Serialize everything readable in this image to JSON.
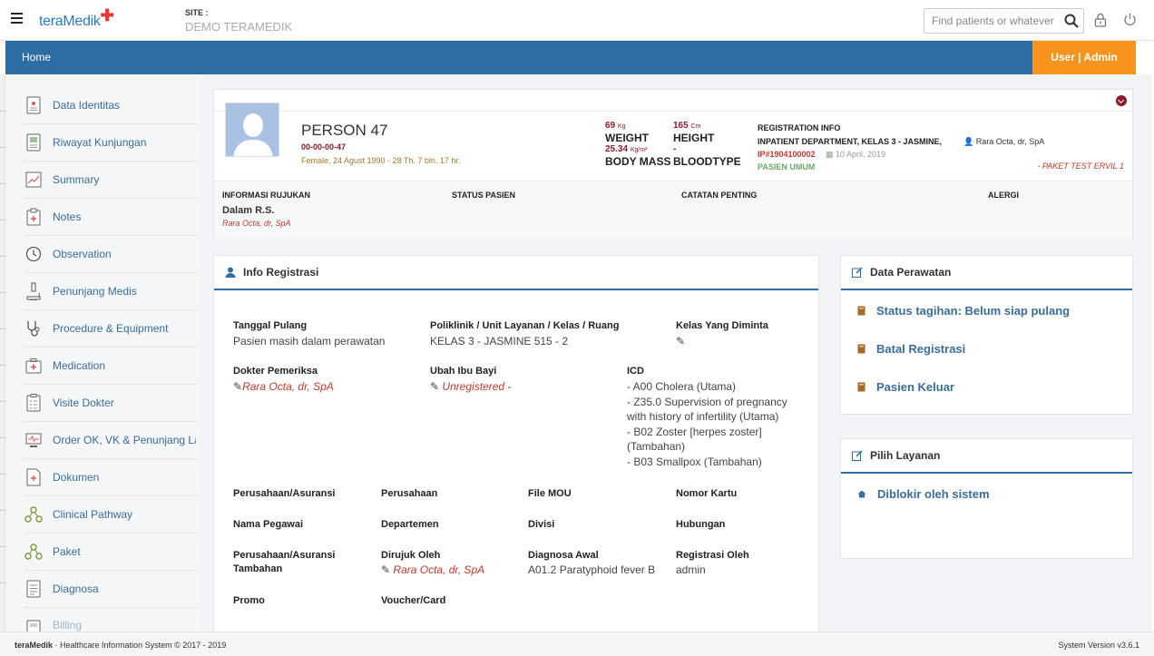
{
  "topbar": {
    "logo_text": "teraMedik",
    "site_label": "SITE :",
    "site_name": "DEMO TERAMEDIK",
    "search_placeholder": "Find patients or whatever"
  },
  "nav": {
    "home": "Home",
    "user": "User | Admin"
  },
  "sidebar": {
    "items": [
      {
        "label": "Data Identitas",
        "icon": "id-card-icon"
      },
      {
        "label": "Riwayat Kunjungan",
        "icon": "visit-history-icon"
      },
      {
        "label": "Summary",
        "icon": "summary-chart-icon"
      },
      {
        "label": "Notes",
        "icon": "notes-icon"
      },
      {
        "label": "Observation",
        "icon": "clock-icon"
      },
      {
        "label": "Penunjang Medis",
        "icon": "microscope-icon"
      },
      {
        "label": "Procedure & Equipment",
        "icon": "stethoscope-icon"
      },
      {
        "label": "Medication",
        "icon": "medkit-icon"
      },
      {
        "label": "Visite Dokter",
        "icon": "clipboard-icon"
      },
      {
        "label": "Order OK, VK & Penunjang La",
        "icon": "monitor-icon"
      },
      {
        "label": "Dokumen",
        "icon": "document-icon"
      },
      {
        "label": "Clinical Pathway",
        "icon": "pathway-icon"
      },
      {
        "label": "Paket",
        "icon": "package-icon"
      },
      {
        "label": "Diagnosa",
        "icon": "diagnosis-icon"
      },
      {
        "label": "Billing",
        "icon": "billing-icon"
      }
    ]
  },
  "patient": {
    "name": "PERSON 47",
    "mrn": "00-00-00-47",
    "info": "Female, 24 Agust 1990 - 28 Th. 7 bln. 17 hr.",
    "weight_value": "69",
    "weight_unit": "Kg",
    "weight_label": "WEIGHT",
    "height_value": "165",
    "height_unit": "Cm",
    "height_label": "HEIGHT",
    "bmi_value": "25.34",
    "bmi_unit": "Kg/m²",
    "bmi_label": "BODY MASS",
    "bloodtype_value": "-",
    "bloodtype_label": "BLOODTYPE",
    "reg_title": "REGISTRATION INFO",
    "reg_dept": "INPATIENT DEPARTMENT, KELAS 3 - JASMINE,",
    "reg_doctor": "Rara Octa, dr, SpA",
    "reg_ip": "IP#1904100002",
    "reg_date": "10 April, 2019",
    "reg_pasien": "PASIEN UMUM",
    "reg_paket": "- PAKET TEST ERVIL 1"
  },
  "info_bar": {
    "rujukan_label": "INFORMASI RUJUKAN",
    "rujukan_value": "Dalam R.S.",
    "rujukan_doctor": "Rara Octa, dr, SpA",
    "status_label": "STATUS PASIEN",
    "catatan_label": "CATATAN PENTING",
    "alergi_label": "ALERGI"
  },
  "registrasi": {
    "title": "Info Registrasi",
    "tanggal_pulang_label": "Tanggal Pulang",
    "tanggal_pulang_value": "Pasien masih dalam perawatan",
    "poliklinik_label": "Poliklinik / Unit Layanan / Kelas / Ruang",
    "poliklinik_value": "KELAS 3 - JASMINE 515 - 2",
    "kelas_label": "Kelas Yang Diminta",
    "dokter_label": "Dokter Pemeriksa",
    "dokter_value": "Rara Octa, dr, SpA",
    "ibu_bayi_label": "Ubah Ibu Bayi",
    "ibu_bayi_value": "Unregistered",
    "ibu_bayi_suffix": " -",
    "icd_label": "ICD",
    "icd_lines": [
      "- A00 Cholera (Utama)",
      "- Z35.0 Supervision of pregnancy",
      "with history of infertility (Utama)",
      "- B02 Zoster [herpes zoster]",
      "(Tambahan)",
      "- B03 Smallpox (Tambahan)"
    ],
    "perusahaan_asuransi_label": "Perusahaan/Asuransi",
    "perusahaan_label": "Perusahaan",
    "file_mou_label": "File MOU",
    "nomor_kartu_label": "Nomor Kartu",
    "nama_pegawai_label": "Nama Pegawai",
    "departemen_label": "Departemen",
    "divisi_label": "Divisi",
    "hubungan_label": "Hubungan",
    "asuransi_tambahan_label_1": "Perusahaan/Asuransi",
    "asuransi_tambahan_label_2": "Tambahan",
    "dirujuk_label": "Dirujuk Oleh",
    "dirujuk_value": "Rara Octa, dr, SpA",
    "diagnosa_awal_label": "Diagnosa Awal",
    "diagnosa_awal_value": "A01.2 Paratyphoid fever B",
    "registrasi_oleh_label": "Registrasi Oleh",
    "registrasi_oleh_value": "admin",
    "promo_label": "Promo",
    "voucher_label": "Voucher/Card"
  },
  "perawatan": {
    "title": "Data Perawatan",
    "actions": [
      "Status tagihan: Belum siap pulang",
      "Batal Registrasi",
      "Pasien Keluar"
    ]
  },
  "layanan": {
    "title": "Pilih Layanan",
    "action": "Diblokir oleh sistem"
  },
  "footer": {
    "brand": "teraMedik",
    "copyright": " · Healthcare Information System © 2017 - 2019",
    "version": "System Version v3.6.1"
  },
  "colors": {
    "nav_blue": "#2c6ea3",
    "user_orange": "#f7941d",
    "maroon": "#8b1a2b",
    "link_blue": "#3a6d98",
    "red": "#c0392b"
  }
}
